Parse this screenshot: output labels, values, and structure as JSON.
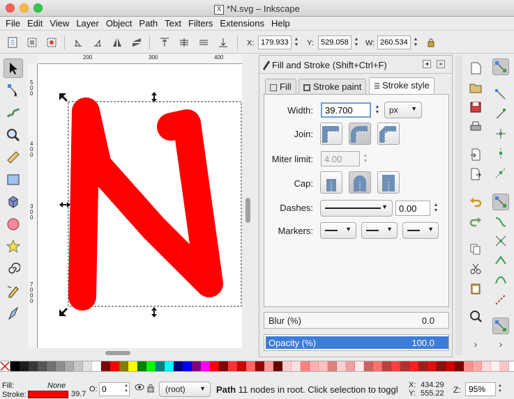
{
  "window": {
    "title": "*N.svg – Inkscape",
    "title_glyph": "X"
  },
  "menu": [
    "File",
    "Edit",
    "View",
    "Layer",
    "Object",
    "Path",
    "Text",
    "Filters",
    "Extensions",
    "Help"
  ],
  "toolbar": {
    "x_label": "X:",
    "x_value": "179.933",
    "y_label": "Y:",
    "y_value": "529.058",
    "w_label": "W:",
    "w_value": "260.534"
  },
  "rulers": {
    "top": [
      "200",
      "300",
      "400"
    ],
    "left": [
      "5",
      "0",
      "0",
      "4",
      "0",
      "0",
      "3",
      "0",
      "0",
      "7",
      "0",
      "0",
      "0"
    ]
  },
  "dialog": {
    "title": "Fill and Stroke (Shift+Ctrl+F)",
    "tabs": [
      "Fill",
      "Stroke paint",
      "Stroke style"
    ],
    "active_tab": "Stroke style",
    "width_label": "Width:",
    "width_value": "39.700",
    "width_unit": "px",
    "join_label": "Join:",
    "miter_label": "Miter limit:",
    "miter_value": "4.00",
    "cap_label": "Cap:",
    "dashes_label": "Dashes:",
    "dashes_value": "0.00",
    "markers_label": "Markers:",
    "blur_label": "Blur (%)",
    "blur_value": "0.0",
    "opacity_label": "Opacity (%)",
    "opacity_value": "100.0",
    "opacity_level": 1.0
  },
  "status": {
    "fill_label": "Fill:",
    "fill_value": "None",
    "stroke_label": "Stroke:",
    "stroke_width": "39.7",
    "stroke_color": "#ff0000",
    "opacity_label": "O:",
    "opacity_value": "0",
    "layer": "(root)",
    "message_bold": "Path",
    "message": " 11 nodes in root. Click selection to toggl",
    "x_label": "X:",
    "x_value": "434.29",
    "y_label": "Y:",
    "y_value": "555.22",
    "zoom_label": "Z:",
    "zoom_value": "95%"
  },
  "colors": {
    "accent": "#3b7dd8",
    "shape": "#ff0000"
  },
  "palette": [
    "#000000",
    "#1c1c1c",
    "#383838",
    "#555555",
    "#717171",
    "#8d8d8d",
    "#aaaaaa",
    "#c6c6c6",
    "#e2e2e2",
    "#ffffff",
    "#800000",
    "#ff0000",
    "#808000",
    "#ffff00",
    "#008000",
    "#00ff00",
    "#008080",
    "#00ffff",
    "#000080",
    "#0000ff",
    "#800080",
    "#ff00ff",
    "#ff0000",
    "#800000",
    "#ff3333",
    "#cc0000",
    "#ff6666",
    "#990000",
    "#ff9999",
    "#660000",
    "#ffcccc",
    "#ffe0e0",
    "#ff8080",
    "#ffb0b0",
    "#ffc0c0",
    "#e08080",
    "#ffd0d0",
    "#f0a0a0",
    "#ffe8e8",
    "#d06060",
    "#ff7070",
    "#c04040",
    "#ff4040",
    "#b03030",
    "#ff2020",
    "#a02020",
    "#e01010",
    "#901010",
    "#d00000",
    "#800000",
    "#ff9090",
    "#ffa8a8",
    "#ffdada",
    "#fff0f0",
    "#f8c8c8"
  ]
}
